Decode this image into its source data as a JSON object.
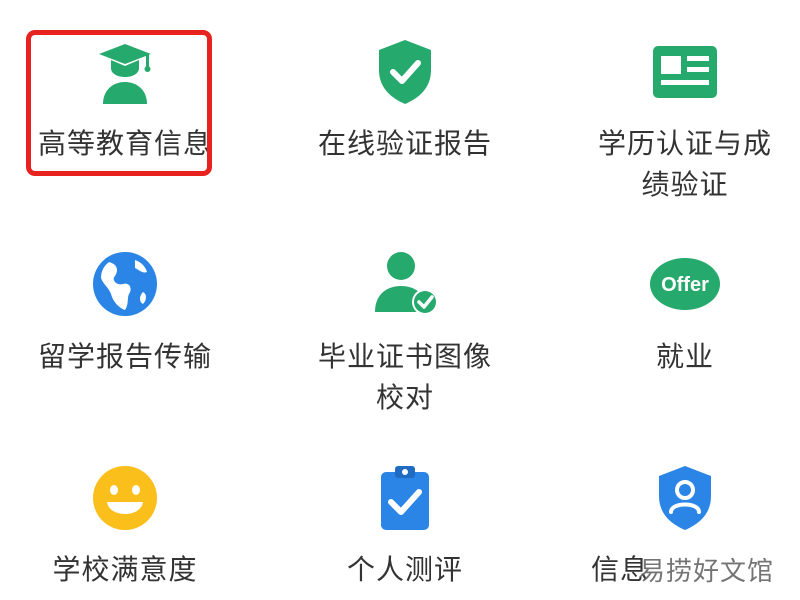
{
  "services": [
    {
      "label": "高等教育信息",
      "label2": "",
      "icon": "graduate-cap-icon",
      "selected": true
    },
    {
      "label": "在线验证报告",
      "label2": "",
      "icon": "shield-check-icon",
      "selected": false
    },
    {
      "label": "学历认证与成",
      "label2": "绩验证",
      "icon": "id-card-icon",
      "selected": false
    },
    {
      "label": "留学报告传输",
      "label2": "",
      "icon": "globe-icon",
      "selected": false
    },
    {
      "label": "毕业证书图像",
      "label2": "校对",
      "icon": "user-verified-icon",
      "selected": false
    },
    {
      "label": "就业",
      "label2": "",
      "icon": "offer-badge-icon",
      "selected": false,
      "badge_text": "Offer"
    },
    {
      "label": "学校满意度",
      "label2": "",
      "icon": "smiley-icon",
      "selected": false
    },
    {
      "label": "个人测评",
      "label2": "",
      "icon": "clipboard-check-icon",
      "selected": false
    },
    {
      "label": "信息",
      "label2": "",
      "icon": "user-shield-icon",
      "selected": false
    }
  ],
  "watermark": "易捞好文馆",
  "colors": {
    "green": "#26a96c",
    "blue": "#2a85e6",
    "yellow": "#fbbf1c",
    "highlight": "#e8231f",
    "text": "#333333"
  }
}
